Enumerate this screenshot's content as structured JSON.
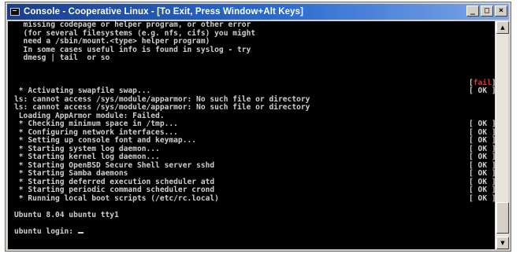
{
  "window": {
    "title": "Console - Cooperative Linux - [To Exit, Press Window+Alt Keys]",
    "icon": "console-icon",
    "buttons": {
      "minimize": "_",
      "maximize": "□",
      "close": "×"
    }
  },
  "console": {
    "lines": [
      {
        "text": "  missing codepage or helper program, or other error",
        "status": ""
      },
      {
        "text": "  (for several filesystems (e.g. nfs, cifs) you might",
        "status": ""
      },
      {
        "text": "  need a /sbin/mount.<type> helper program)",
        "status": ""
      },
      {
        "text": "  In some cases useful info is found in syslog - try",
        "status": ""
      },
      {
        "text": "  dmesg | tail  or so",
        "status": ""
      },
      {
        "text": "",
        "status": ""
      },
      {
        "text": "",
        "status": ""
      },
      {
        "text": "",
        "status_prefix": "[",
        "status_word": "fail",
        "status_suffix": "]",
        "fail": true
      },
      {
        "text": " * Activating swapfile swap...",
        "status": "[ OK ]"
      },
      {
        "text": "ls: cannot access /sys/module/apparmor: No such file or directory",
        "status": ""
      },
      {
        "text": "ls: cannot access /sys/module/apparmor: No such file or directory",
        "status": ""
      },
      {
        "text": " Loading AppArmor module: Failed.",
        "status": ""
      },
      {
        "text": " * Checking minimum space in /tmp...",
        "status": "[ OK ]"
      },
      {
        "text": " * Configuring network interfaces...",
        "status": "[ OK ]"
      },
      {
        "text": " * Setting up console font and keymap...",
        "status": "[ OK ]"
      },
      {
        "text": " * Starting system log daemon...",
        "status": "[ OK ]"
      },
      {
        "text": " * Starting kernel log daemon...",
        "status": "[ OK ]"
      },
      {
        "text": " * Starting OpenBSD Secure Shell server sshd",
        "status": "[ OK ]"
      },
      {
        "text": " * Starting Samba daemons",
        "status": "[ OK ]"
      },
      {
        "text": " * Starting deferred execution scheduler atd",
        "status": "[ OK ]"
      },
      {
        "text": " * Starting periodic command scheduler crond",
        "status": "[ OK ]"
      },
      {
        "text": " * Running local boot scripts (/etc/rc.local)",
        "status": "[ OK ]"
      },
      {
        "text": "",
        "status": ""
      },
      {
        "text": "Ubuntu 8.04 ubuntu tty1",
        "status": ""
      },
      {
        "text": "",
        "status": ""
      },
      {
        "text": "ubuntu login: ",
        "status": "",
        "cursor": true
      }
    ]
  }
}
